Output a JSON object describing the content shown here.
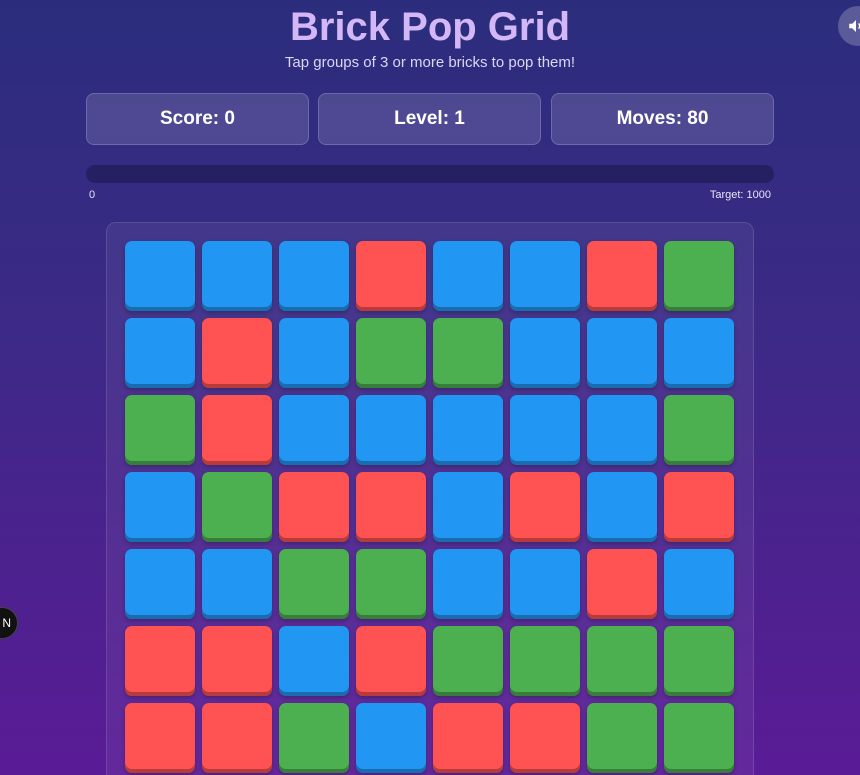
{
  "header": {
    "title": "Brick Pop Grid",
    "subtitle": "Tap groups of 3 or more bricks to pop them!"
  },
  "sound_button": {
    "icon": "speaker-icon"
  },
  "stats": {
    "score_label": "Score: 0",
    "level_label": "Level: 1",
    "moves_label": "Moves: 80"
  },
  "progress": {
    "start_label": "0",
    "target_label": "Target: 1000",
    "fraction": 0
  },
  "side_badge": {
    "label": "N"
  },
  "colors": {
    "B": "#2196f3",
    "R": "#ff5252",
    "G": "#4caf50"
  },
  "grid": [
    [
      "B",
      "B",
      "B",
      "R",
      "B",
      "B",
      "R",
      "G"
    ],
    [
      "B",
      "R",
      "B",
      "G",
      "G",
      "B",
      "B",
      "B"
    ],
    [
      "G",
      "R",
      "B",
      "B",
      "B",
      "B",
      "B",
      "G"
    ],
    [
      "B",
      "G",
      "R",
      "R",
      "B",
      "R",
      "B",
      "R"
    ],
    [
      "B",
      "B",
      "G",
      "G",
      "B",
      "B",
      "R",
      "B"
    ],
    [
      "R",
      "R",
      "B",
      "R",
      "G",
      "G",
      "G",
      "G"
    ],
    [
      "R",
      "R",
      "G",
      "B",
      "R",
      "R",
      "G",
      "G"
    ]
  ]
}
